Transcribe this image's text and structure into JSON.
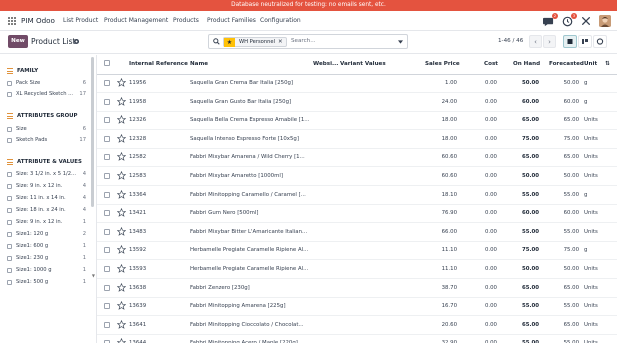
{
  "banner": {
    "text": "Database neutralized for testing: no emails sent, etc."
  },
  "navbar": {
    "brand": "PIM Odoo",
    "menus": [
      "List Product",
      "Product Management",
      "Products",
      "Product Families",
      "Configuration"
    ],
    "chat_badge": "2",
    "activity_badge": "3"
  },
  "controls": {
    "new_label": "New",
    "title": "Product List",
    "facet_label": "WH Personnel",
    "search_placeholder": "Search...",
    "pager": "1-46 / 46"
  },
  "sidebar": {
    "sections": [
      {
        "title": "FAMILY",
        "items": [
          {
            "label": "Pack Size",
            "count": "6"
          },
          {
            "label": "XL Recycled Sketch ...",
            "count": "17"
          }
        ]
      },
      {
        "title": "ATTRIBUTES GROUP",
        "items": [
          {
            "label": "Size",
            "count": "6"
          },
          {
            "label": "Sketch Pads",
            "count": "17"
          }
        ]
      },
      {
        "title": "ATTRIBUTE & VALUES",
        "items": [
          {
            "label": "Size: 3 1/2 in. x 5 1/2...",
            "count": "4"
          },
          {
            "label": "Size: 9 in. x 12 in.",
            "count": "4"
          },
          {
            "label": "Size: 11 in. x 14 in.",
            "count": "4"
          },
          {
            "label": "Size: 18 in. x 24 in.",
            "count": "4"
          },
          {
            "label": "Size: 9 in. x 12 in.",
            "count": "1"
          },
          {
            "label": "Size1: 120 g",
            "count": "2"
          },
          {
            "label": "Size1: 600 g",
            "count": "1"
          },
          {
            "label": "Size1: 230 g",
            "count": "1"
          },
          {
            "label": "Size1: 1000 g",
            "count": "1"
          },
          {
            "label": "Size1: 500 g",
            "count": "1"
          }
        ]
      }
    ]
  },
  "table": {
    "headers": {
      "ref": "Internal Reference",
      "name": "Name",
      "website": "Websi...",
      "variants": "Variant Values",
      "price": "Sales Price",
      "cost": "Cost",
      "onhand": "On Hand",
      "forecast": "Forecasted",
      "unit": "Unit"
    },
    "rows": [
      {
        "ref": "11956",
        "name": "Saquella Gran Crema Bar Italia [250g]",
        "price": "1.00",
        "cost": "0.00",
        "onhand": "50.00",
        "forecast": "50.00",
        "unit": "g"
      },
      {
        "ref": "11958",
        "name": "Saquella Gran Gusto Bar Italia [250g]",
        "price": "24.00",
        "cost": "0.00",
        "onhand": "60.00",
        "forecast": "60.00",
        "unit": "g"
      },
      {
        "ref": "12326",
        "name": "Saquella Bella Crema Espresso Amabile [1...",
        "price": "18.00",
        "cost": "0.00",
        "onhand": "65.00",
        "forecast": "65.00",
        "unit": "Units"
      },
      {
        "ref": "12328",
        "name": "Saquella Intenso Espresso Forte [10x5g]",
        "price": "18.00",
        "cost": "0.00",
        "onhand": "75.00",
        "forecast": "75.00",
        "unit": "Units"
      },
      {
        "ref": "12582",
        "name": "Fabbri Mixybar Amarena / Wild Cherry [1...",
        "price": "60.60",
        "cost": "0.00",
        "onhand": "65.00",
        "forecast": "65.00",
        "unit": "Units"
      },
      {
        "ref": "12583",
        "name": "Fabbri Mixybar Amaretto [1000ml]",
        "price": "60.60",
        "cost": "0.00",
        "onhand": "50.00",
        "forecast": "50.00",
        "unit": "Units"
      },
      {
        "ref": "13364",
        "name": "Fabbri Minitopping Caramello / Caramel [...",
        "price": "18.10",
        "cost": "0.00",
        "onhand": "55.00",
        "forecast": "55.00",
        "unit": "g"
      },
      {
        "ref": "13421",
        "name": "Fabbri Gum Nero [500ml]",
        "price": "76.90",
        "cost": "0.00",
        "onhand": "60.00",
        "forecast": "60.00",
        "unit": "Units"
      },
      {
        "ref": "13483",
        "name": "Fabbri Mixybar Bitter L'Amaricante Italian...",
        "price": "66.00",
        "cost": "0.00",
        "onhand": "55.00",
        "forecast": "55.00",
        "unit": "Units"
      },
      {
        "ref": "13592",
        "name": "Herbamelle Pregiate Caramelle Ripiene Al...",
        "price": "11.10",
        "cost": "0.00",
        "onhand": "75.00",
        "forecast": "75.00",
        "unit": "g"
      },
      {
        "ref": "13593",
        "name": "Herbamelle Pregiate Caramelle Ripiene Al...",
        "price": "11.10",
        "cost": "0.00",
        "onhand": "50.00",
        "forecast": "50.00",
        "unit": "Units"
      },
      {
        "ref": "13638",
        "name": "Fabbri Zenzero [230g]",
        "price": "38.70",
        "cost": "0.00",
        "onhand": "65.00",
        "forecast": "65.00",
        "unit": "Units"
      },
      {
        "ref": "13639",
        "name": "Fabbri Minitopping Amarena [225g]",
        "price": "16.70",
        "cost": "0.00",
        "onhand": "55.00",
        "forecast": "55.00",
        "unit": "Units"
      },
      {
        "ref": "13641",
        "name": "Fabbri Minitopping Cioccolato / Chocolat...",
        "price": "20.60",
        "cost": "0.00",
        "onhand": "65.00",
        "forecast": "65.00",
        "unit": "Units"
      },
      {
        "ref": "13644",
        "name": "Fabbri Minitopping Acero / Maple [220g]",
        "price": "32.90",
        "cost": "0.00",
        "onhand": "55.00",
        "forecast": "55.00",
        "unit": "Units"
      }
    ]
  },
  "colors": {
    "brand": "#714b67",
    "banner": "#e4533f",
    "accent": "#017e84",
    "facet_star": "#ffc107"
  }
}
